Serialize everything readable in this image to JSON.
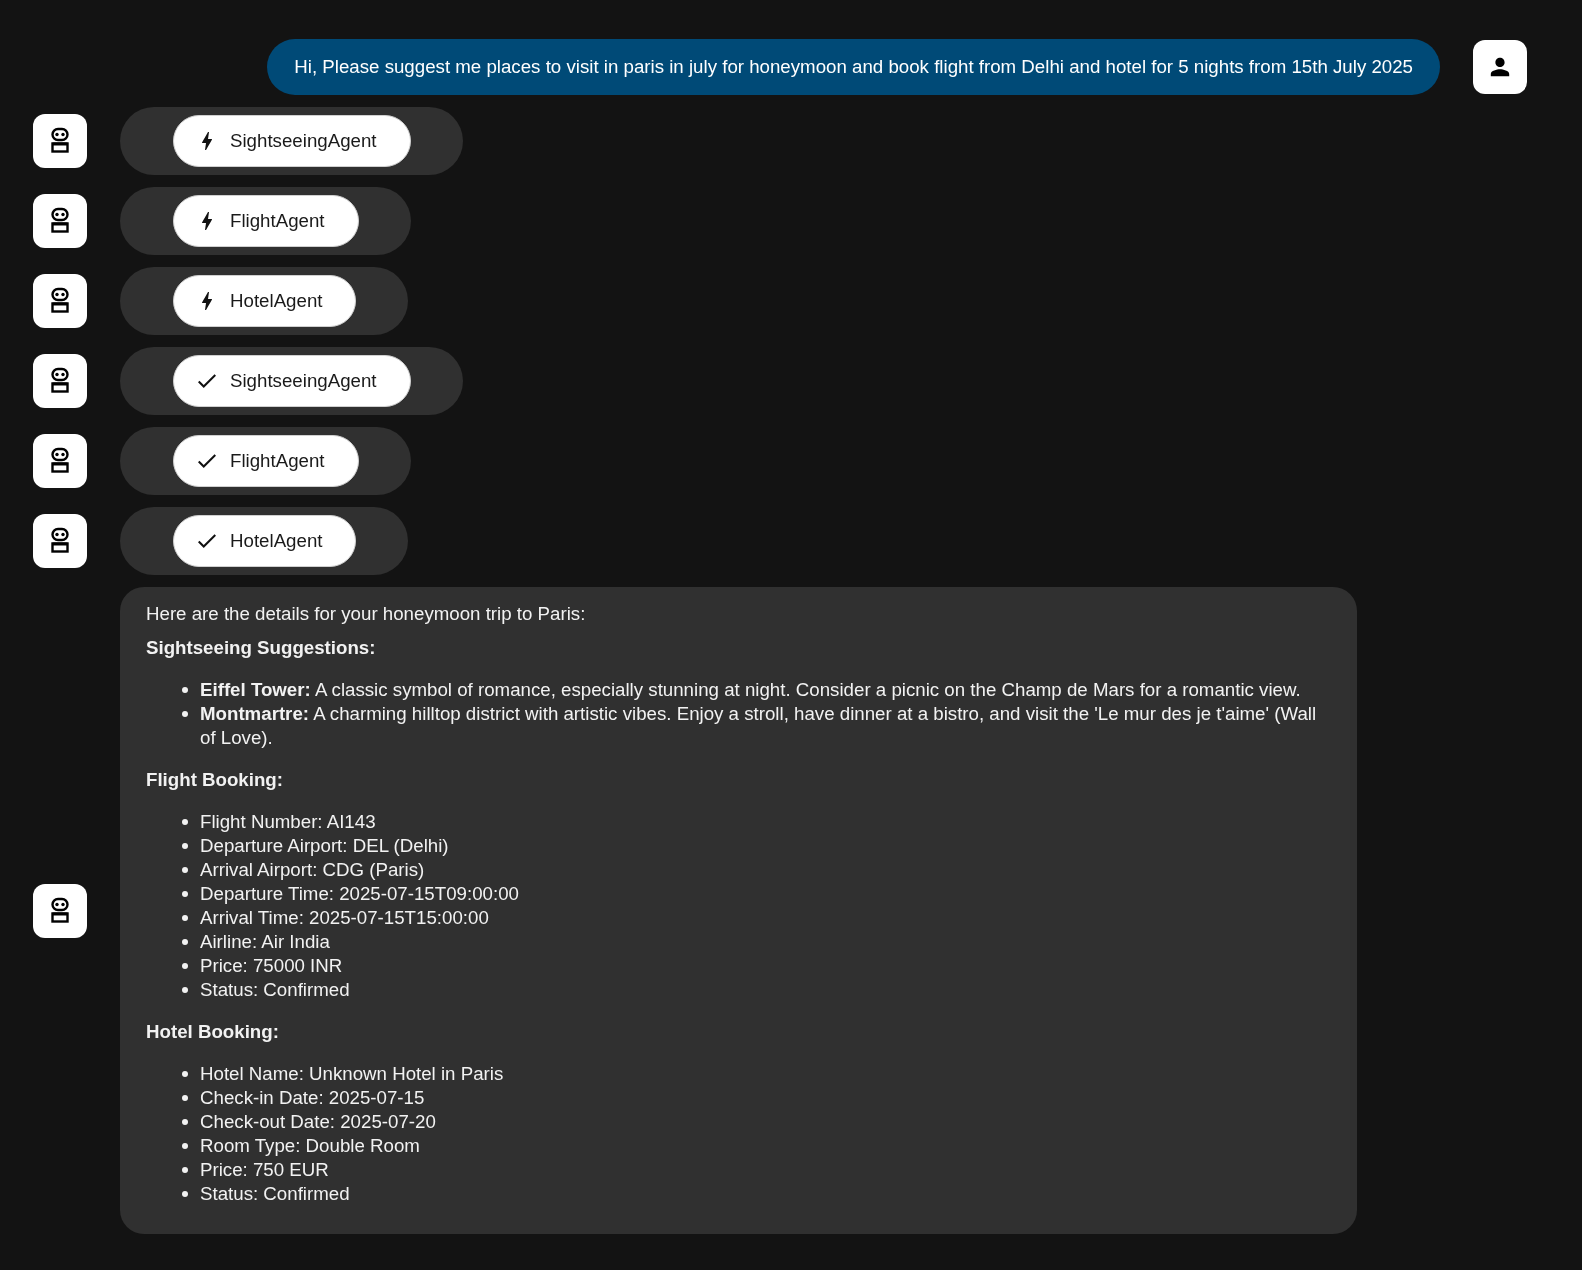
{
  "user_message": {
    "text": "Hi, Please suggest me places to visit in paris in july for honeymoon and book flight from Delhi and hotel for 5 nights from 15th July 2025"
  },
  "agent_events": [
    {
      "agent": "SightseeingAgent",
      "completed": false
    },
    {
      "agent": "FlightAgent",
      "completed": false
    },
    {
      "agent": "HotelAgent",
      "completed": false
    },
    {
      "agent": "SightseeingAgent",
      "completed": true
    },
    {
      "agent": "FlightAgent",
      "completed": true
    },
    {
      "agent": "HotelAgent",
      "completed": true
    }
  ],
  "response": {
    "intro": "Here are the details for your honeymoon trip to Paris:",
    "sections": [
      {
        "heading": "Sightseeing Suggestions:",
        "items": [
          "**Eiffel Tower:** A classic symbol of romance, especially stunning at night. Consider a picnic on the Champ de Mars for a romantic view.",
          "**Montmartre:** A charming hilltop district with artistic vibes. Enjoy a stroll, have dinner at a bistro, and visit the 'Le mur des je t'aime' (Wall of Love)."
        ]
      },
      {
        "heading": "Flight Booking:",
        "items": [
          "Flight Number: AI143",
          "Departure Airport: DEL (Delhi)",
          "Arrival Airport: CDG (Paris)",
          "Departure Time: 2025-07-15T09:00:00",
          "Arrival Time: 2025-07-15T15:00:00",
          "Airline: Air India",
          "Price: 75000 INR",
          "Status: Confirmed"
        ]
      },
      {
        "heading": "Hotel Booking:",
        "items": [
          "Hotel Name: Unknown Hotel in Paris",
          "Check-in Date: 2025-07-15",
          "Check-out Date: 2025-07-20",
          "Room Type: Double Room",
          "Price: 750 EUR",
          "Status: Confirmed"
        ]
      }
    ]
  }
}
